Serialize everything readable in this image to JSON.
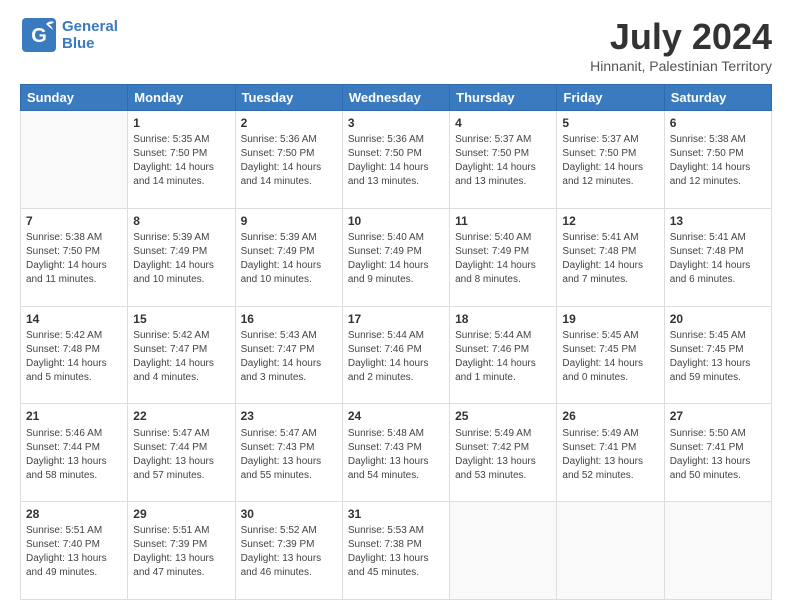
{
  "header": {
    "logo_general": "General",
    "logo_blue": "Blue",
    "main_title": "July 2024",
    "sub_title": "Hinnanit, Palestinian Territory"
  },
  "days_of_week": [
    "Sunday",
    "Monday",
    "Tuesday",
    "Wednesday",
    "Thursday",
    "Friday",
    "Saturday"
  ],
  "weeks": [
    [
      {
        "day": "",
        "info": ""
      },
      {
        "day": "1",
        "info": "Sunrise: 5:35 AM\nSunset: 7:50 PM\nDaylight: 14 hours\nand 14 minutes."
      },
      {
        "day": "2",
        "info": "Sunrise: 5:36 AM\nSunset: 7:50 PM\nDaylight: 14 hours\nand 14 minutes."
      },
      {
        "day": "3",
        "info": "Sunrise: 5:36 AM\nSunset: 7:50 PM\nDaylight: 14 hours\nand 13 minutes."
      },
      {
        "day": "4",
        "info": "Sunrise: 5:37 AM\nSunset: 7:50 PM\nDaylight: 14 hours\nand 13 minutes."
      },
      {
        "day": "5",
        "info": "Sunrise: 5:37 AM\nSunset: 7:50 PM\nDaylight: 14 hours\nand 12 minutes."
      },
      {
        "day": "6",
        "info": "Sunrise: 5:38 AM\nSunset: 7:50 PM\nDaylight: 14 hours\nand 12 minutes."
      }
    ],
    [
      {
        "day": "7",
        "info": "Sunrise: 5:38 AM\nSunset: 7:50 PM\nDaylight: 14 hours\nand 11 minutes."
      },
      {
        "day": "8",
        "info": "Sunrise: 5:39 AM\nSunset: 7:49 PM\nDaylight: 14 hours\nand 10 minutes."
      },
      {
        "day": "9",
        "info": "Sunrise: 5:39 AM\nSunset: 7:49 PM\nDaylight: 14 hours\nand 10 minutes."
      },
      {
        "day": "10",
        "info": "Sunrise: 5:40 AM\nSunset: 7:49 PM\nDaylight: 14 hours\nand 9 minutes."
      },
      {
        "day": "11",
        "info": "Sunrise: 5:40 AM\nSunset: 7:49 PM\nDaylight: 14 hours\nand 8 minutes."
      },
      {
        "day": "12",
        "info": "Sunrise: 5:41 AM\nSunset: 7:48 PM\nDaylight: 14 hours\nand 7 minutes."
      },
      {
        "day": "13",
        "info": "Sunrise: 5:41 AM\nSunset: 7:48 PM\nDaylight: 14 hours\nand 6 minutes."
      }
    ],
    [
      {
        "day": "14",
        "info": "Sunrise: 5:42 AM\nSunset: 7:48 PM\nDaylight: 14 hours\nand 5 minutes."
      },
      {
        "day": "15",
        "info": "Sunrise: 5:42 AM\nSunset: 7:47 PM\nDaylight: 14 hours\nand 4 minutes."
      },
      {
        "day": "16",
        "info": "Sunrise: 5:43 AM\nSunset: 7:47 PM\nDaylight: 14 hours\nand 3 minutes."
      },
      {
        "day": "17",
        "info": "Sunrise: 5:44 AM\nSunset: 7:46 PM\nDaylight: 14 hours\nand 2 minutes."
      },
      {
        "day": "18",
        "info": "Sunrise: 5:44 AM\nSunset: 7:46 PM\nDaylight: 14 hours\nand 1 minute."
      },
      {
        "day": "19",
        "info": "Sunrise: 5:45 AM\nSunset: 7:45 PM\nDaylight: 14 hours\nand 0 minutes."
      },
      {
        "day": "20",
        "info": "Sunrise: 5:45 AM\nSunset: 7:45 PM\nDaylight: 13 hours\nand 59 minutes."
      }
    ],
    [
      {
        "day": "21",
        "info": "Sunrise: 5:46 AM\nSunset: 7:44 PM\nDaylight: 13 hours\nand 58 minutes."
      },
      {
        "day": "22",
        "info": "Sunrise: 5:47 AM\nSunset: 7:44 PM\nDaylight: 13 hours\nand 57 minutes."
      },
      {
        "day": "23",
        "info": "Sunrise: 5:47 AM\nSunset: 7:43 PM\nDaylight: 13 hours\nand 55 minutes."
      },
      {
        "day": "24",
        "info": "Sunrise: 5:48 AM\nSunset: 7:43 PM\nDaylight: 13 hours\nand 54 minutes."
      },
      {
        "day": "25",
        "info": "Sunrise: 5:49 AM\nSunset: 7:42 PM\nDaylight: 13 hours\nand 53 minutes."
      },
      {
        "day": "26",
        "info": "Sunrise: 5:49 AM\nSunset: 7:41 PM\nDaylight: 13 hours\nand 52 minutes."
      },
      {
        "day": "27",
        "info": "Sunrise: 5:50 AM\nSunset: 7:41 PM\nDaylight: 13 hours\nand 50 minutes."
      }
    ],
    [
      {
        "day": "28",
        "info": "Sunrise: 5:51 AM\nSunset: 7:40 PM\nDaylight: 13 hours\nand 49 minutes."
      },
      {
        "day": "29",
        "info": "Sunrise: 5:51 AM\nSunset: 7:39 PM\nDaylight: 13 hours\nand 47 minutes."
      },
      {
        "day": "30",
        "info": "Sunrise: 5:52 AM\nSunset: 7:39 PM\nDaylight: 13 hours\nand 46 minutes."
      },
      {
        "day": "31",
        "info": "Sunrise: 5:53 AM\nSunset: 7:38 PM\nDaylight: 13 hours\nand 45 minutes."
      },
      {
        "day": "",
        "info": ""
      },
      {
        "day": "",
        "info": ""
      },
      {
        "day": "",
        "info": ""
      }
    ]
  ]
}
